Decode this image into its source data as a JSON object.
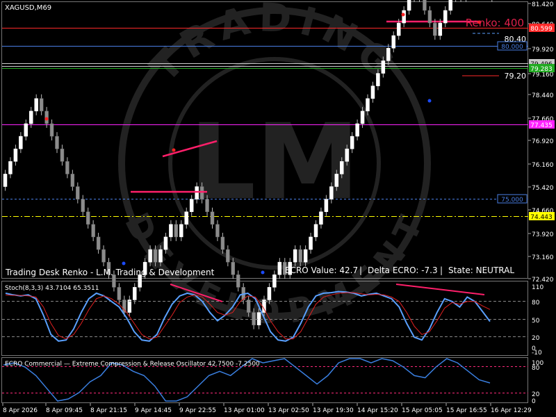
{
  "window": {
    "symbol_timeframe": "XAGUSD,M69"
  },
  "overlay": {
    "renko_label": "Renko: 400",
    "desk_label": "Trading Desk Renko - L.M. Trading & Development",
    "ecro_value": "ECRO Value: 42.7",
    "delta_ecro": "Delta ECRO: -7.3",
    "state": "State: NEUTRAL",
    "separator": "|",
    "watermark_top": "TRADING",
    "watermark_bottom": "DEVELOPMENT",
    "watermark_logo": "LM",
    "level_80_40": "80.40",
    "level_79_20": "79.20"
  },
  "price_axis": {
    "ticks": [
      "81.420",
      "80.640",
      "79.920",
      "79.160",
      "78.440",
      "77.660",
      "76.920",
      "76.160",
      "75.420",
      "74.660",
      "73.920",
      "73.160",
      "72.420"
    ],
    "badges": [
      {
        "text": "80.599",
        "color": "#ff2a2a"
      },
      {
        "text": "80.000",
        "color": "#2d6ad6"
      },
      {
        "text": "79.496",
        "color": "#c8c8c8"
      },
      {
        "text": "79.283",
        "color": "#22aa22"
      },
      {
        "text": "77.435",
        "color": "#ff22ff"
      },
      {
        "text": "75.000",
        "color": "#2d6ad6"
      },
      {
        "text": "74.443",
        "color": "#ffff00"
      }
    ]
  },
  "stoch": {
    "label": "Stoch(8,3,3) 43.7104 65.3511",
    "ticks": [
      "110",
      "80",
      "50",
      "20",
      "0",
      "-10"
    ]
  },
  "ecro": {
    "label": "ECRO Commercial — Extreme Compression & Release Oscillator 42.7500 -7.2500",
    "ticks": [
      "100",
      "80",
      "20",
      "0"
    ]
  },
  "time_axis": {
    "labels": [
      "8 Apr 2026",
      "8 Apr 09:45",
      "8 Apr 21:15",
      "9 Apr 14:45",
      "9 Apr 22:55",
      "13 Apr 01:00",
      "13 Apr 02:50",
      "13 Apr 19:30",
      "14 Apr 15:20",
      "15 Apr 05:05",
      "15 Apr 16:55",
      "16 Apr 12:29"
    ]
  },
  "colors": {
    "bull": "#ffffff",
    "bear": "#8c8c8c",
    "red_line": "#ff2a2a",
    "blue_line": "#5aa0ff",
    "pink": "#ff1f6a",
    "grid": "#7a7a7a",
    "dots_red": "#ff2222",
    "dots_blue": "#1b4bff"
  },
  "chart_data": {
    "type": "renko-candlestick",
    "brick_size": 400,
    "bricks_dir": [
      1,
      1,
      1,
      1,
      1,
      1,
      1,
      -1,
      -1,
      -1,
      -1,
      -1,
      -1,
      -1,
      -1,
      -1,
      -1,
      -1,
      -1,
      -1,
      -1,
      -1,
      -1,
      -1,
      1,
      1,
      1,
      1,
      1,
      -1,
      1,
      1,
      1,
      -1,
      1,
      1,
      1,
      1,
      -1,
      -1,
      -1,
      -1,
      -1,
      -1,
      -1,
      -1,
      -1,
      -1,
      -1,
      1,
      1,
      1,
      1,
      1,
      -1,
      1,
      1,
      -1,
      1,
      1,
      1,
      1,
      1,
      1,
      1,
      1,
      1,
      1,
      1,
      1,
      1,
      1,
      1,
      1,
      1,
      1,
      1,
      1,
      1,
      1,
      -1,
      -1,
      -1,
      -1,
      1,
      1,
      1,
      1,
      -1,
      1,
      1,
      1,
      -1,
      -1,
      -1
    ],
    "start_price": 75.4,
    "stoch_main": [
      95,
      92,
      90,
      92,
      85,
      55,
      20,
      8,
      10,
      30,
      60,
      85,
      95,
      90,
      80,
      70,
      50,
      25,
      10,
      8,
      20,
      50,
      75,
      90,
      95,
      92,
      80,
      60,
      45,
      55,
      70,
      92,
      95,
      85,
      55,
      25,
      10,
      8,
      15,
      40,
      70,
      90,
      95,
      96,
      98,
      97,
      95,
      90,
      93,
      95,
      90,
      85,
      70,
      40,
      15,
      10,
      30,
      60,
      85,
      80,
      70,
      88,
      80,
      62,
      43.7
    ],
    "stoch_signal": [
      92,
      91,
      91,
      90,
      88,
      70,
      40,
      18,
      12,
      20,
      40,
      65,
      85,
      90,
      85,
      75,
      60,
      40,
      20,
      12,
      15,
      35,
      55,
      78,
      88,
      92,
      88,
      75,
      60,
      55,
      60,
      80,
      90,
      88,
      70,
      45,
      25,
      12,
      12,
      25,
      50,
      75,
      88,
      92,
      95,
      96,
      96,
      94,
      92,
      93,
      92,
      88,
      80,
      60,
      35,
      20,
      25,
      45,
      68,
      78,
      75,
      80,
      80,
      72,
      65.4
    ],
    "ecro_line": [
      85,
      90,
      80,
      60,
      30,
      0,
      5,
      20,
      45,
      60,
      90,
      85,
      70,
      60,
      35,
      0,
      0,
      10,
      35,
      60,
      70,
      60,
      80,
      100,
      90,
      95,
      100,
      80,
      60,
      40,
      60,
      90,
      100,
      100,
      90,
      100,
      95,
      80,
      60,
      55,
      80,
      100,
      90,
      70,
      50,
      42.7
    ]
  }
}
